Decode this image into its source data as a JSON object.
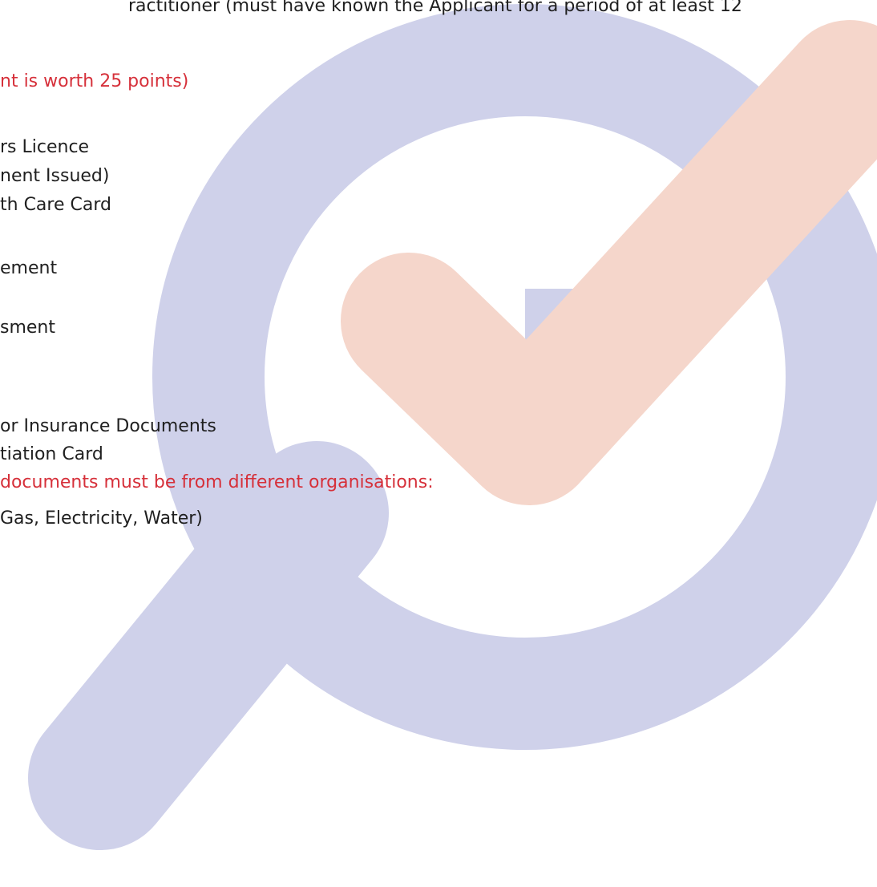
{
  "document": {
    "intro_line": "ractitioner (must have known the Applicant for a period of at least 12",
    "points_note": "nt is worth 25 points)",
    "items_25pt": [
      "rs Licence",
      "nent Issued)",
      "th Care Card",
      "ement",
      "sment"
    ],
    "items_other": [
      "or Insurance Documents",
      "tiation Card"
    ],
    "different_org_note": "documents must be from different organisations:",
    "utilities_item": "Gas, Electricity, Water)"
  },
  "watermark": {
    "icon": "magnifier-check-icon",
    "lens_color": "#cfd1ea",
    "check_color": "#f5d6cb"
  },
  "colors": {
    "text": "#1f1f1f",
    "accent_red": "#d6303a"
  }
}
